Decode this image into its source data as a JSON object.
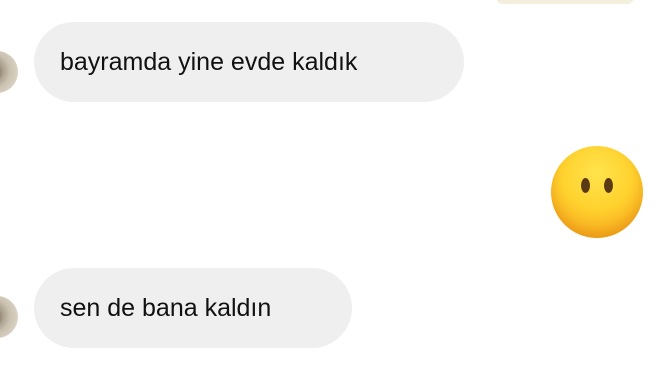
{
  "conversation": {
    "messages": [
      {
        "direction": "incoming",
        "text": "bayramda yine evde kaldık"
      },
      {
        "direction": "outgoing",
        "emoji": "😶",
        "icon": "face-without-mouth-emoji"
      },
      {
        "direction": "incoming",
        "text": "sen de bana kaldın"
      }
    ]
  },
  "colors": {
    "incoming_bubble": "#efefef",
    "text": "#111111",
    "background": "#ffffff"
  }
}
